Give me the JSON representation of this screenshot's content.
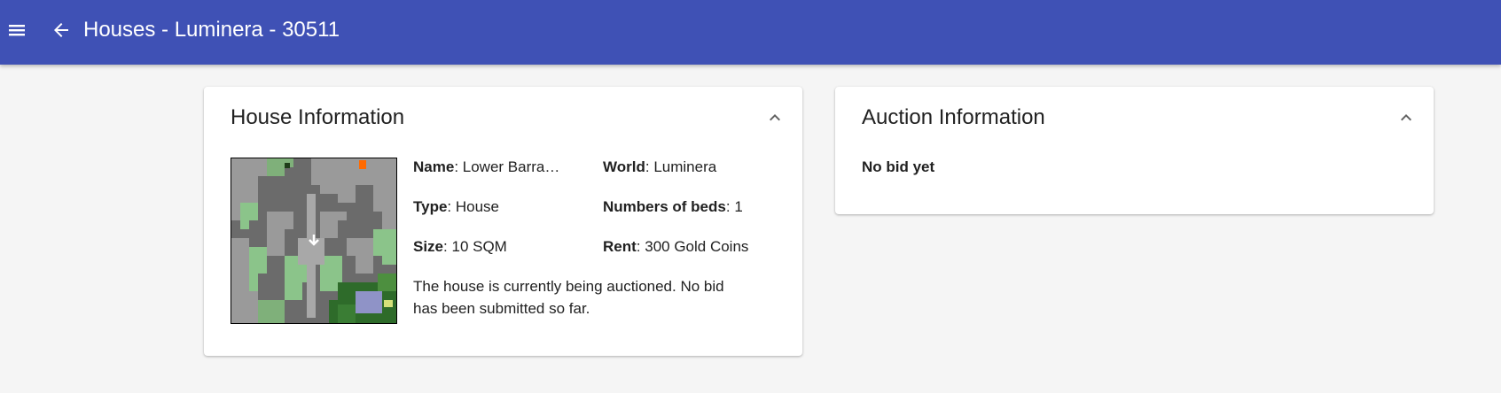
{
  "header": {
    "title": "Houses - Luminera - 30511",
    "menu_icon": "hamburger-menu-icon",
    "back_icon": "arrow-left-icon"
  },
  "house_card": {
    "title": "House Information",
    "collapse_icon": "chevron-up-icon",
    "fields": {
      "name_label": "Name",
      "name_value": "Lower Barra…",
      "world_label": "World",
      "world_value": "Luminera",
      "type_label": "Type",
      "type_value": "House",
      "beds_label": "Numbers of beds",
      "beds_value": "1",
      "size_label": "Size",
      "size_value": "10 SQM",
      "rent_label": "Rent",
      "rent_value": "300 Gold Coins"
    },
    "status_text": "The house is currently being auctioned. No bid has been submitted so far."
  },
  "auction_card": {
    "title": "Auction Information",
    "collapse_icon": "chevron-up-icon",
    "status": "No bid yet"
  },
  "colors": {
    "appbar": "#3f51b5",
    "background": "#f5f5f5",
    "card": "#ffffff",
    "text": "#212121"
  }
}
